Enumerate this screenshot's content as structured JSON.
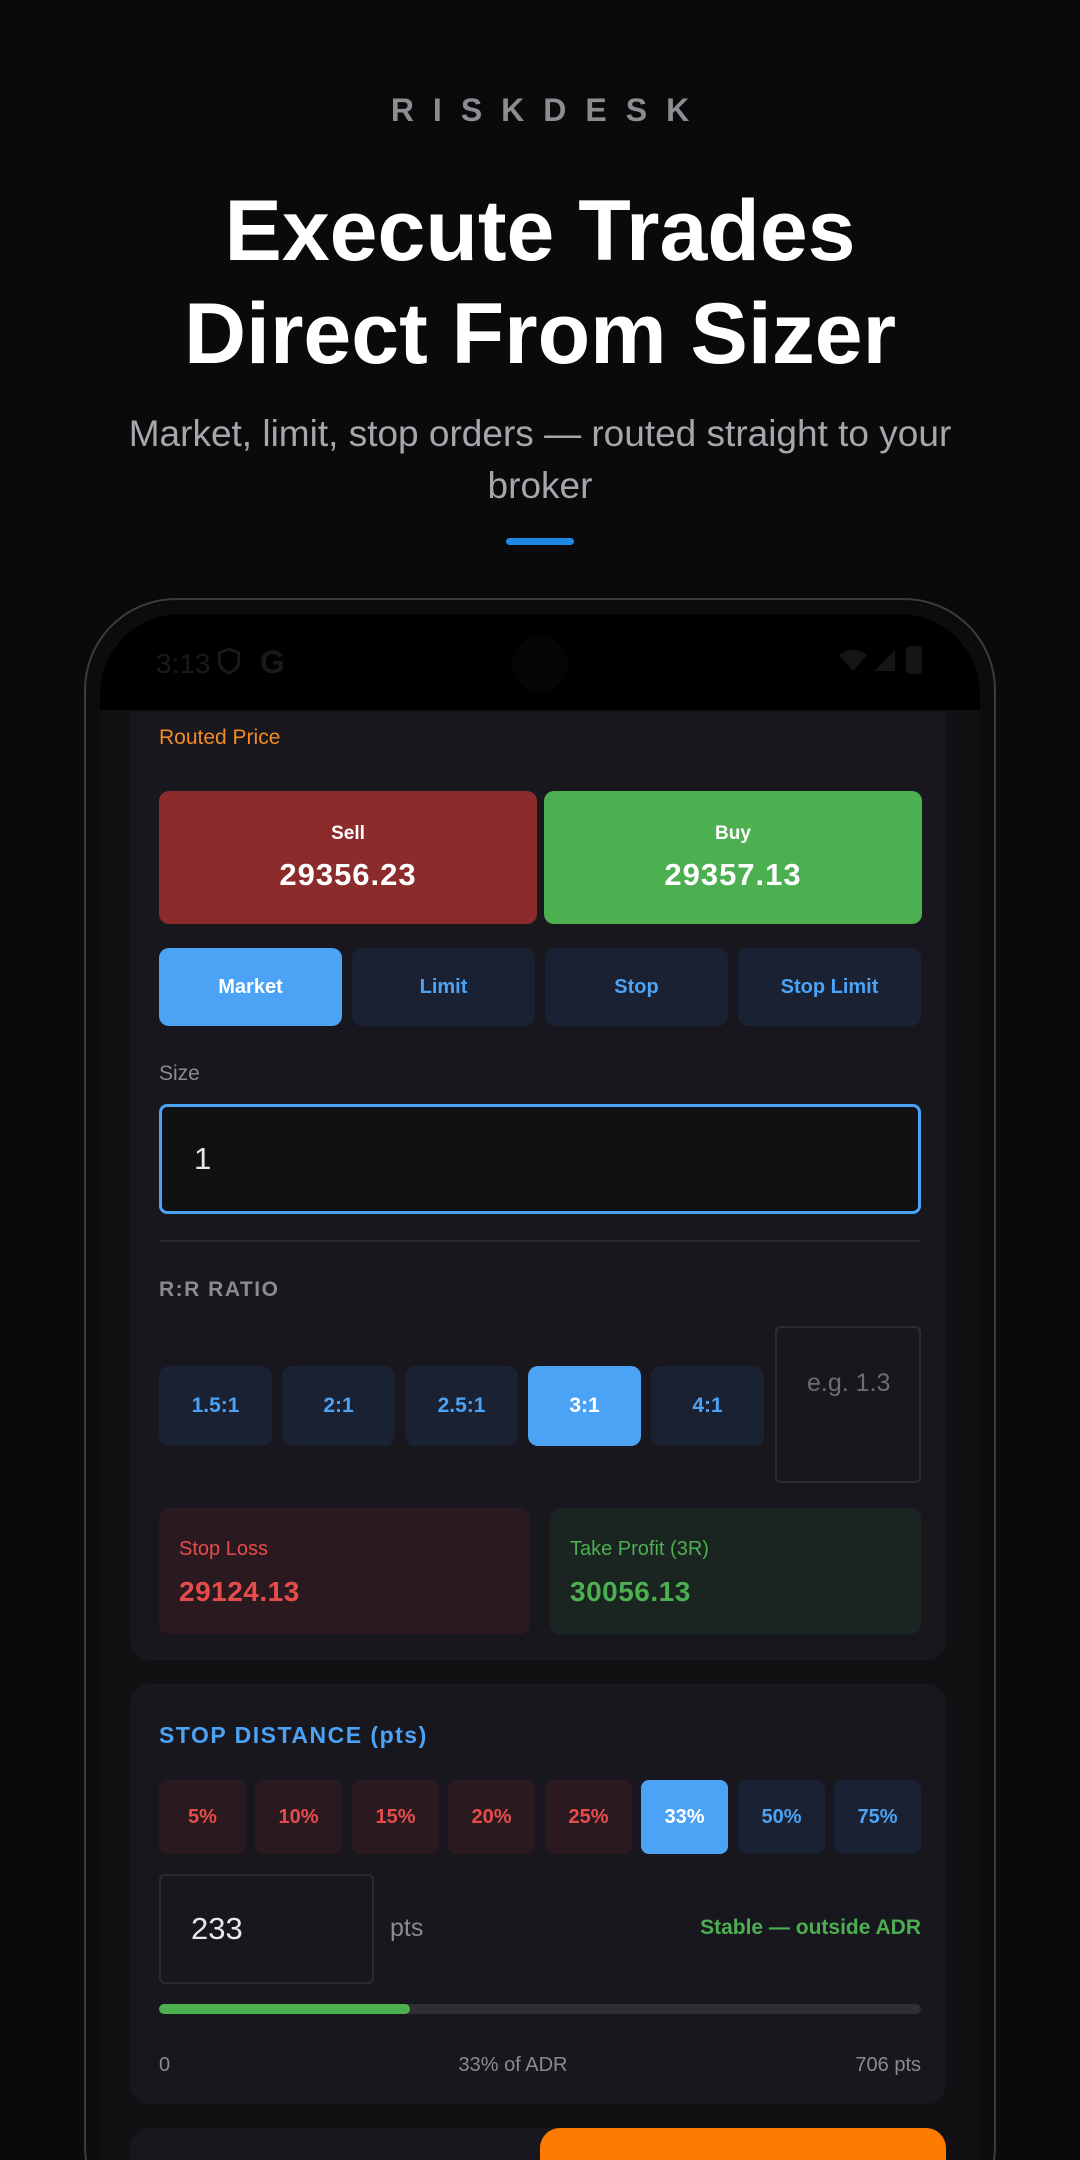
{
  "promo": {
    "brand": "RISKDESK",
    "headline_line1": "Execute Trades",
    "headline_line2": "Direct From Sizer",
    "subline": "Market, limit, stop orders — routed straight to your broker"
  },
  "status_bar": {
    "time": "3:13"
  },
  "order": {
    "routed_label": "Routed Price",
    "sell": {
      "label": "Sell",
      "price": "29356.23"
    },
    "buy": {
      "label": "Buy",
      "price": "29357.13"
    },
    "order_types": [
      "Market",
      "Limit",
      "Stop",
      "Stop Limit"
    ],
    "selected_order_type": "Market",
    "size_label": "Size",
    "size_value": "1"
  },
  "rr": {
    "label": "R:R RATIO",
    "options": [
      "1.5:1",
      "2:1",
      "2.5:1",
      "3:1",
      "4:1"
    ],
    "selected": "3:1",
    "custom_placeholder": "e.g. 1.3",
    "stop_loss_label": "Stop Loss",
    "stop_loss_value": "29124.13",
    "take_profit_label": "Take Profit (3R)",
    "take_profit_value": "30056.13"
  },
  "stop_distance": {
    "title": "STOP DISTANCE (pts)",
    "percent_options": [
      "5%",
      "10%",
      "15%",
      "20%",
      "25%",
      "33%",
      "50%",
      "75%"
    ],
    "selected": "33%",
    "value": "233",
    "unit": "pts",
    "status": "Stable — outside ADR",
    "progress_fraction": 0.33,
    "scale_min": "0",
    "scale_mid": "33% of ADR",
    "scale_max": "706 pts"
  },
  "colors": {
    "accent_blue": "#4ca3f5",
    "sell_red": "#8b2b2b",
    "buy_green": "#4caf50",
    "routed_orange": "#f28a26",
    "cta_orange": "#ff7a00"
  }
}
